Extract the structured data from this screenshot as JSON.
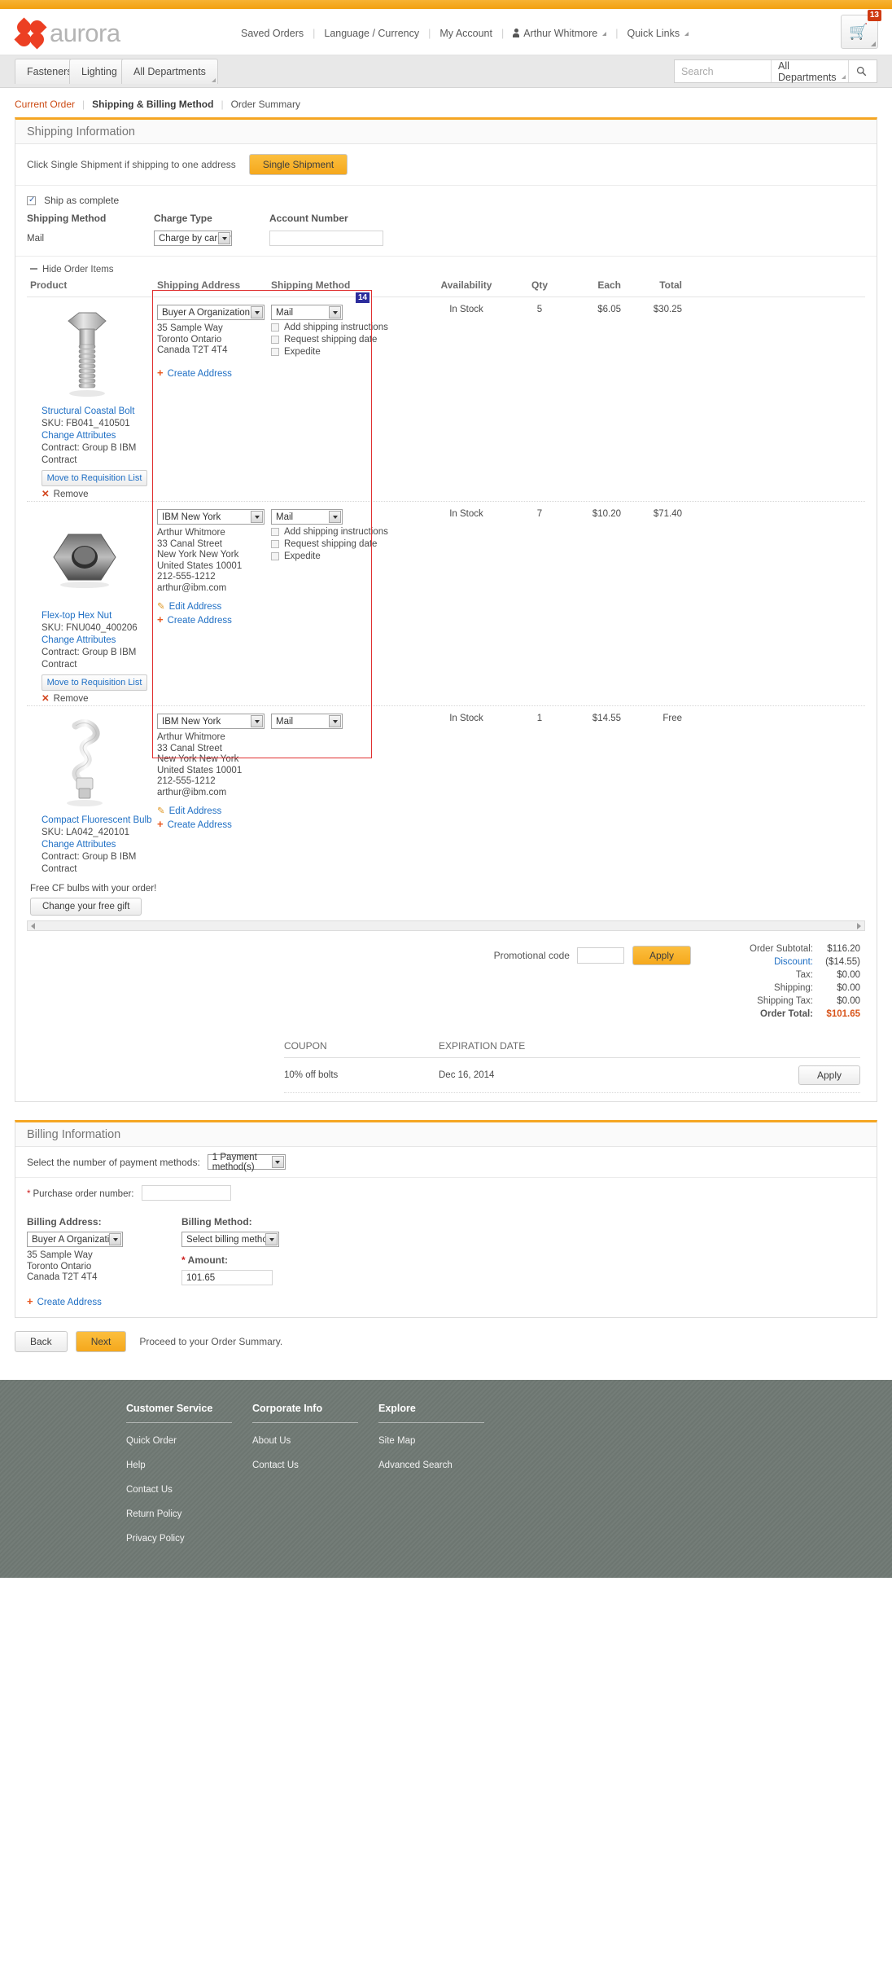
{
  "header": {
    "brand": "aurora",
    "nav": [
      {
        "label": "Saved Orders",
        "caret": false
      },
      {
        "label": "Language / Currency",
        "caret": false
      },
      {
        "label": "My Account",
        "caret": false
      },
      {
        "label": "Arthur Whitmore",
        "caret": true
      },
      {
        "label": "Quick Links",
        "caret": true
      }
    ],
    "cart_count": "13"
  },
  "deptnav": {
    "items": [
      "Fasteners",
      "Lighting",
      "All Departments"
    ],
    "search_placeholder": "Search",
    "search_value": "",
    "scope": "All Departments"
  },
  "breadcrumb": {
    "current": "Current Order",
    "active": "Shipping & Billing Method",
    "next": "Order Summary"
  },
  "shipping": {
    "title": "Shipping Information",
    "single_shipment_hint": "Click Single Shipment if shipping to one address",
    "single_shipment_button": "Single Shipment",
    "ship_as_complete": "Ship as complete",
    "ship_as_complete_checked": true,
    "col_shipping_method": "Shipping Method",
    "col_charge_type": "Charge Type",
    "col_account_number": "Account Number",
    "method_value": "Mail",
    "charge_type_value": "Charge by carrier",
    "account_number_value": "",
    "hide_order_items": "Hide Order Items",
    "annotation_badge": "14"
  },
  "items_table": {
    "headers": {
      "product": "Product",
      "shipping_address": "Shipping Address",
      "shipping_method": "Shipping Method",
      "availability": "Availability",
      "qty": "Qty",
      "each": "Each",
      "total": "Total"
    },
    "checkbox_labels": [
      "Add shipping instructions",
      "Request shipping date",
      "Expedite"
    ],
    "links": {
      "change_attributes": "Change Attributes",
      "move_to_requisition": "Move to Requisition List",
      "remove": "Remove",
      "edit_address": "Edit Address",
      "create_address": "Create Address"
    },
    "rows": [
      {
        "icon": "bolt-icon",
        "name": "Structural Coastal Bolt",
        "sku": "SKU: FB041_410501",
        "contract": "Contract: Group B IBM Contract",
        "address_select": "Buyer A Organization",
        "address_lines": [
          "35 Sample Way",
          "Toronto Ontario",
          "Canada T2T 4T4"
        ],
        "has_edit_address": false,
        "has_actions": true,
        "method": "Mail",
        "availability": "In Stock",
        "qty": "5",
        "each": "$6.05",
        "total": "$30.25"
      },
      {
        "icon": "hex-nut-icon",
        "name": "Flex-top Hex Nut",
        "sku": "SKU: FNU040_400206",
        "contract": "Contract: Group B IBM Contract",
        "address_select": "IBM New York",
        "address_lines": [
          "Arthur Whitmore",
          "33 Canal Street",
          "New York New York",
          "United States 10001",
          "212-555-1212",
          "arthur@ibm.com"
        ],
        "has_edit_address": true,
        "has_actions": true,
        "method": "Mail",
        "availability": "In Stock",
        "qty": "7",
        "each": "$10.20",
        "total": "$71.40"
      },
      {
        "icon": "cfl-bulb-icon",
        "name": "Compact Fluorescent Bulb",
        "sku": "SKU: LA042_420101",
        "contract": "Contract: Group B IBM Contract",
        "address_select": "IBM New York",
        "address_lines": [
          "Arthur Whitmore",
          "33 Canal Street",
          "New York New York",
          "United States 10001",
          "212-555-1212",
          "arthur@ibm.com"
        ],
        "has_edit_address": true,
        "has_actions": false,
        "method": "Mail",
        "availability": "In Stock",
        "qty": "1",
        "each": "$14.55",
        "total": "Free"
      }
    ]
  },
  "free_gift": {
    "text": "Free CF bulbs with your order!",
    "button": "Change your free gift"
  },
  "promo": {
    "label": "Promotional code",
    "value": "",
    "apply": "Apply"
  },
  "totals": [
    {
      "label": "Order Subtotal:",
      "value": "$116.20",
      "kind": "normal"
    },
    {
      "label": "Discount:",
      "value": "($14.55)",
      "kind": "disc"
    },
    {
      "label": "Tax:",
      "value": "$0.00",
      "kind": "normal"
    },
    {
      "label": "Shipping:",
      "value": "$0.00",
      "kind": "normal"
    },
    {
      "label": "Shipping Tax:",
      "value": "$0.00",
      "kind": "normal"
    },
    {
      "label": "Order Total:",
      "value": "$101.65",
      "kind": "grand"
    }
  ],
  "coupons": {
    "col_coupon": "COUPON",
    "col_expiration": "EXPIRATION DATE",
    "rows": [
      {
        "coupon": "10% off bolts",
        "expiration": "Dec 16, 2014",
        "apply": "Apply"
      }
    ]
  },
  "billing": {
    "title": "Billing Information",
    "payment_methods_label": "Select the number of payment methods:",
    "payment_methods_value": "1 Payment method(s)",
    "po_label": "Purchase order number:",
    "po_value": "",
    "billing_address_label": "Billing Address:",
    "billing_address_value": "Buyer A Organization",
    "billing_address_lines": [
      "35 Sample Way",
      "Toronto Ontario",
      "Canada T2T 4T4"
    ],
    "billing_method_label": "Billing Method:",
    "billing_method_value": "Select billing method",
    "amount_label": "Amount:",
    "amount_value": "101.65",
    "create_address": "Create Address"
  },
  "actions": {
    "back": "Back",
    "next": "Next",
    "note": "Proceed to your Order Summary."
  },
  "footer": {
    "columns": [
      {
        "title": "Customer Service",
        "links": [
          "Quick Order",
          "Help",
          "Contact Us",
          "Return Policy",
          "Privacy Policy"
        ]
      },
      {
        "title": "Corporate Info",
        "links": [
          "About Us",
          "Contact Us"
        ]
      },
      {
        "title": "Explore",
        "links": [
          "Site Map",
          "Advanced Search"
        ]
      }
    ]
  }
}
